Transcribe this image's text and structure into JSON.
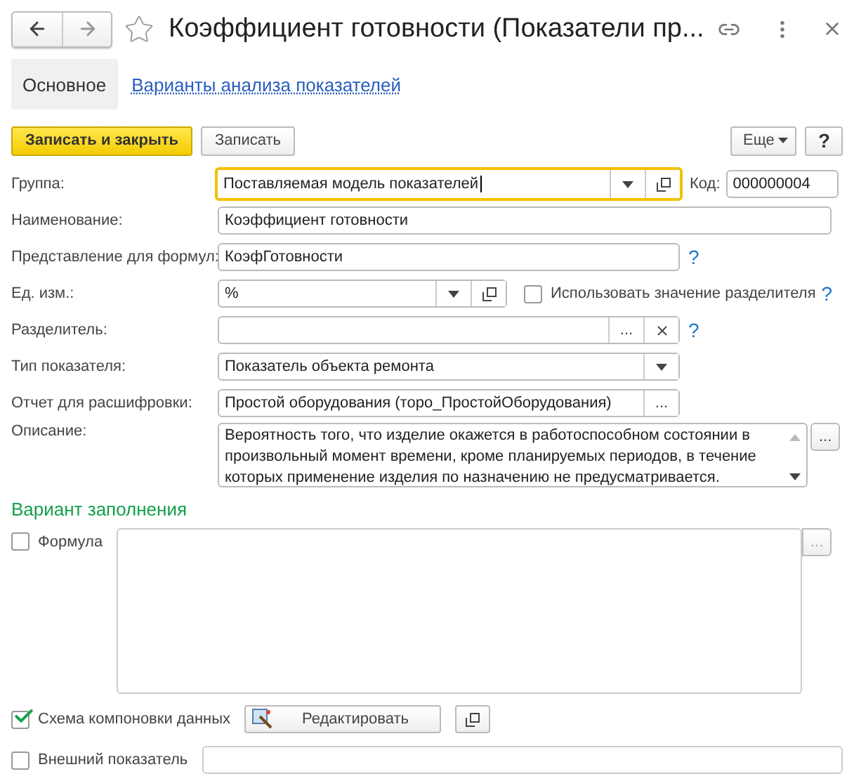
{
  "window": {
    "title": "Коэффициент готовности (Показатели пр..."
  },
  "tabs": [
    {
      "label": "Основное",
      "selected": true
    },
    {
      "label": "Варианты анализа показателей",
      "selected": false
    }
  ],
  "toolbar": {
    "buttons": [
      {
        "kind": "primary",
        "label": "Записать и закрыть"
      },
      {
        "kind": "plain",
        "label": "Записать"
      }
    ],
    "more": "Еще",
    "help": "?"
  },
  "fields": [
    {
      "label": "Группа:",
      "value": "Поставляемая модель показателей",
      "focused": true,
      "buttons": [
        {
          "kind": "dropdown"
        },
        {
          "kind": "open"
        }
      ],
      "code": {
        "label": "Код:",
        "value": "000000004"
      }
    },
    {
      "label": "Наименование:",
      "value": "Коэффициент готовности",
      "focused": false
    },
    {
      "label": "Представление для формул:",
      "value": "КоэфГотовности",
      "focused": false,
      "help": "?"
    },
    {
      "label": "Ед. изм.:",
      "value": "%",
      "focused": false,
      "buttons": [
        {
          "kind": "dropdown"
        },
        {
          "kind": "open"
        }
      ],
      "option": {
        "label": "Использовать значение разделителя",
        "checked": false,
        "help": "?"
      }
    },
    {
      "label": "Разделитель:",
      "focused": false,
      "buttons": [
        {
          "kind": "choose",
          "text": "..."
        },
        {
          "kind": "clear"
        }
      ],
      "help": "?"
    },
    {
      "label": "Тип показателя:",
      "value": "Показатель объекта ремонта",
      "focused": false,
      "buttons": [
        {
          "kind": "dropdown"
        }
      ]
    },
    {
      "label": "Отчет для расшифровки:",
      "value": "Простой оборудования (торо_ПростойОборудования)",
      "focused": false,
      "buttons": [
        {
          "kind": "choose",
          "text": "..."
        }
      ]
    }
  ],
  "description": {
    "label": "Описание:",
    "value": "Вероятность того, что изделие окажется в работоспособном состоянии в произвольный момент времени, кроме планируемых периодов, в течение которых применение изделия по назначению не предусматривается.",
    "button": "..."
  },
  "fill_variant": {
    "title": "Вариант заполнения",
    "formula": {
      "label": "Формула",
      "checked": false,
      "button": "...",
      "disabled": true
    },
    "schema": {
      "label": "Схема компоновки данных",
      "checked": true,
      "edit_button": "Редактировать"
    },
    "external": {
      "label": "Внешний показатель",
      "checked": false
    }
  }
}
